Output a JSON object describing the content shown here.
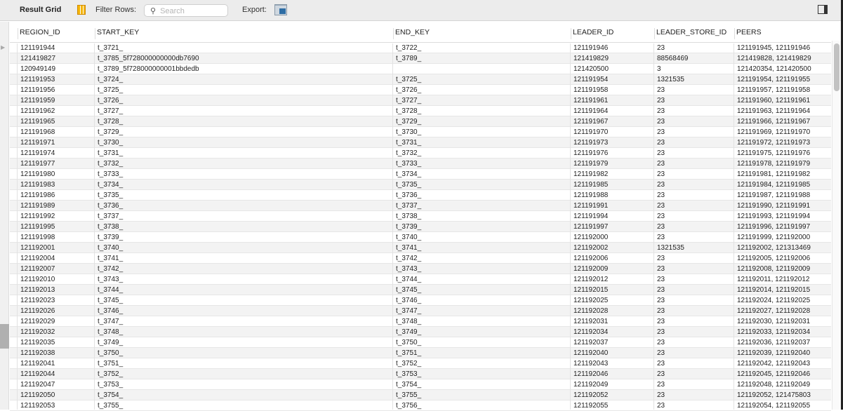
{
  "toolbar": {
    "title": "Result Grid",
    "filter_label": "Filter Rows:",
    "search_placeholder": "Search",
    "export_label": "Export:"
  },
  "columns": [
    "REGION_ID",
    "START_KEY",
    "END_KEY",
    "LEADER_ID",
    "LEADER_STORE_ID",
    "PEERS"
  ],
  "rows": [
    [
      "121191944",
      "t_3721_",
      "t_3722_",
      "121191946",
      "23",
      "121191945, 121191946"
    ],
    [
      "121419827",
      "t_3785_5f728000000000db7690",
      "t_3789_",
      "121419829",
      "88568469",
      "121419828, 121419829"
    ],
    [
      "120949149",
      "t_3789_5f728000000001bbdedb",
      "",
      "121420500",
      "3",
      "121420354, 121420500"
    ],
    [
      "121191953",
      "t_3724_",
      "t_3725_",
      "121191954",
      "1321535",
      "121191954, 121191955"
    ],
    [
      "121191956",
      "t_3725_",
      "t_3726_",
      "121191958",
      "23",
      "121191957, 121191958"
    ],
    [
      "121191959",
      "t_3726_",
      "t_3727_",
      "121191961",
      "23",
      "121191960, 121191961"
    ],
    [
      "121191962",
      "t_3727_",
      "t_3728_",
      "121191964",
      "23",
      "121191963, 121191964"
    ],
    [
      "121191965",
      "t_3728_",
      "t_3729_",
      "121191967",
      "23",
      "121191966, 121191967"
    ],
    [
      "121191968",
      "t_3729_",
      "t_3730_",
      "121191970",
      "23",
      "121191969, 121191970"
    ],
    [
      "121191971",
      "t_3730_",
      "t_3731_",
      "121191973",
      "23",
      "121191972, 121191973"
    ],
    [
      "121191974",
      "t_3731_",
      "t_3732_",
      "121191976",
      "23",
      "121191975, 121191976"
    ],
    [
      "121191977",
      "t_3732_",
      "t_3733_",
      "121191979",
      "23",
      "121191978, 121191979"
    ],
    [
      "121191980",
      "t_3733_",
      "t_3734_",
      "121191982",
      "23",
      "121191981, 121191982"
    ],
    [
      "121191983",
      "t_3734_",
      "t_3735_",
      "121191985",
      "23",
      "121191984, 121191985"
    ],
    [
      "121191986",
      "t_3735_",
      "t_3736_",
      "121191988",
      "23",
      "121191987, 121191988"
    ],
    [
      "121191989",
      "t_3736_",
      "t_3737_",
      "121191991",
      "23",
      "121191990, 121191991"
    ],
    [
      "121191992",
      "t_3737_",
      "t_3738_",
      "121191994",
      "23",
      "121191993, 121191994"
    ],
    [
      "121191995",
      "t_3738_",
      "t_3739_",
      "121191997",
      "23",
      "121191996, 121191997"
    ],
    [
      "121191998",
      "t_3739_",
      "t_3740_",
      "121192000",
      "23",
      "121191999, 121192000"
    ],
    [
      "121192001",
      "t_3740_",
      "t_3741_",
      "121192002",
      "1321535",
      "121192002, 121313469"
    ],
    [
      "121192004",
      "t_3741_",
      "t_3742_",
      "121192006",
      "23",
      "121192005, 121192006"
    ],
    [
      "121192007",
      "t_3742_",
      "t_3743_",
      "121192009",
      "23",
      "121192008, 121192009"
    ],
    [
      "121192010",
      "t_3743_",
      "t_3744_",
      "121192012",
      "23",
      "121192011, 121192012"
    ],
    [
      "121192013",
      "t_3744_",
      "t_3745_",
      "121192015",
      "23",
      "121192014, 121192015"
    ],
    [
      "121192023",
      "t_3745_",
      "t_3746_",
      "121192025",
      "23",
      "121192024, 121192025"
    ],
    [
      "121192026",
      "t_3746_",
      "t_3747_",
      "121192028",
      "23",
      "121192027, 121192028"
    ],
    [
      "121192029",
      "t_3747_",
      "t_3748_",
      "121192031",
      "23",
      "121192030, 121192031"
    ],
    [
      "121192032",
      "t_3748_",
      "t_3749_",
      "121192034",
      "23",
      "121192033, 121192034"
    ],
    [
      "121192035",
      "t_3749_",
      "t_3750_",
      "121192037",
      "23",
      "121192036, 121192037"
    ],
    [
      "121192038",
      "t_3750_",
      "t_3751_",
      "121192040",
      "23",
      "121192039, 121192040"
    ],
    [
      "121192041",
      "t_3751_",
      "t_3752_",
      "121192043",
      "23",
      "121192042, 121192043"
    ],
    [
      "121192044",
      "t_3752_",
      "t_3753_",
      "121192046",
      "23",
      "121192045, 121192046"
    ],
    [
      "121192047",
      "t_3753_",
      "t_3754_",
      "121192049",
      "23",
      "121192048, 121192049"
    ],
    [
      "121192050",
      "t_3754_",
      "t_3755_",
      "121192052",
      "23",
      "121192052, 121475803"
    ],
    [
      "121192053",
      "t_3755_",
      "t_3756_",
      "121192055",
      "23",
      "121192054, 121192055"
    ]
  ]
}
